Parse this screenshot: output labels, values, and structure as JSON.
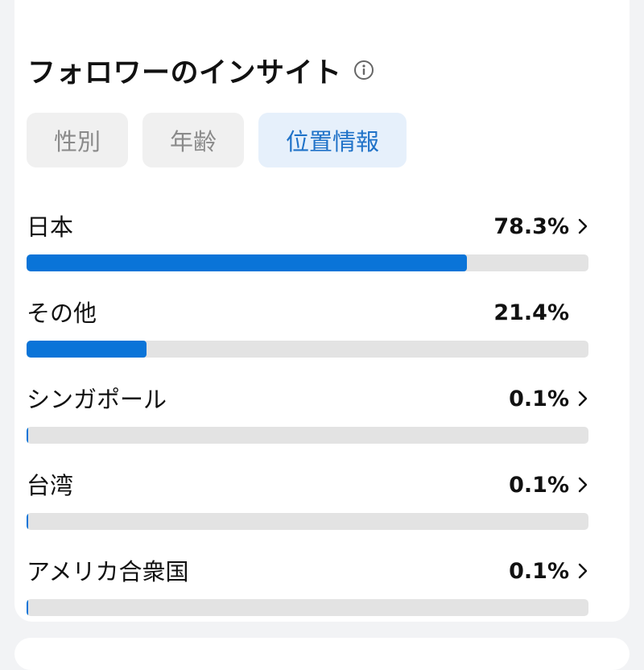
{
  "header": {
    "title": "フォロワーのインサイト",
    "info_icon": "info-icon"
  },
  "tabs": [
    {
      "label": "性別",
      "active": false
    },
    {
      "label": "年齢",
      "active": false
    },
    {
      "label": "位置情報",
      "active": true
    }
  ],
  "locations": [
    {
      "name": "日本",
      "percent_label": "78.3%",
      "fraction": 0.783,
      "has_chevron": true
    },
    {
      "name": "その他",
      "percent_label": "21.4%",
      "fraction": 0.214,
      "has_chevron": false
    },
    {
      "name": "シンガポール",
      "percent_label": "0.1%",
      "fraction": 0.001,
      "has_chevron": true
    },
    {
      "name": "台湾",
      "percent_label": "0.1%",
      "fraction": 0.001,
      "has_chevron": true
    },
    {
      "name": "アメリカ合衆国",
      "percent_label": "0.1%",
      "fraction": 0.001,
      "has_chevron": true
    }
  ],
  "colors": {
    "bar_fill": "#0a74d8",
    "bar_track": "#e3e3e3",
    "active_tab_bg": "#e6f0fb",
    "active_tab_text": "#1f72c8"
  }
}
